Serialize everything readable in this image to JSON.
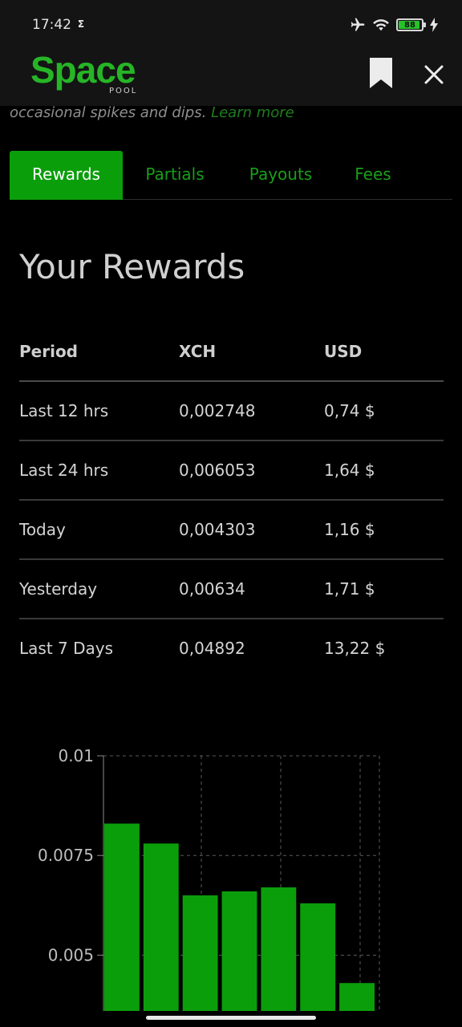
{
  "status_bar": {
    "time": "17:42",
    "sigma": "Σ",
    "battery": "88"
  },
  "header": {
    "logo_text": "Space",
    "logo_sub": "POOL"
  },
  "intro": {
    "text": "occasional spikes and dips. ",
    "link": "Learn more"
  },
  "tabs": [
    {
      "label": "Rewards",
      "active": true
    },
    {
      "label": "Partials",
      "active": false
    },
    {
      "label": "Payouts",
      "active": false
    },
    {
      "label": "Fees",
      "active": false
    }
  ],
  "rewards": {
    "title": "Your Rewards",
    "headers": [
      "Period",
      "XCH",
      "USD"
    ],
    "rows": [
      [
        "Last 12 hrs",
        "0,002748",
        "0,74 $"
      ],
      [
        "Last 24 hrs",
        "0,006053",
        "1,64 $"
      ],
      [
        "Today",
        "0,004303",
        "1,16 $"
      ],
      [
        "Yesterday",
        "0,00634",
        "1,71 $"
      ],
      [
        "Last 7 Days",
        "0,04892",
        "13,22 $"
      ]
    ]
  },
  "colors": {
    "accent": "#0b9e0b",
    "bar": "#0b9e0b",
    "background": "#000000",
    "header": "#141414"
  },
  "chart_data": {
    "type": "bar",
    "categories": [
      "",
      "",
      "",
      "",
      "",
      "",
      ""
    ],
    "values": [
      0.0083,
      0.0078,
      0.0065,
      0.0066,
      0.0067,
      0.0063,
      0.0043
    ],
    "yticks": [
      "0.01",
      "0.0075",
      "0.005"
    ],
    "ylim": [
      0.0036,
      0.01
    ],
    "grid": true
  }
}
